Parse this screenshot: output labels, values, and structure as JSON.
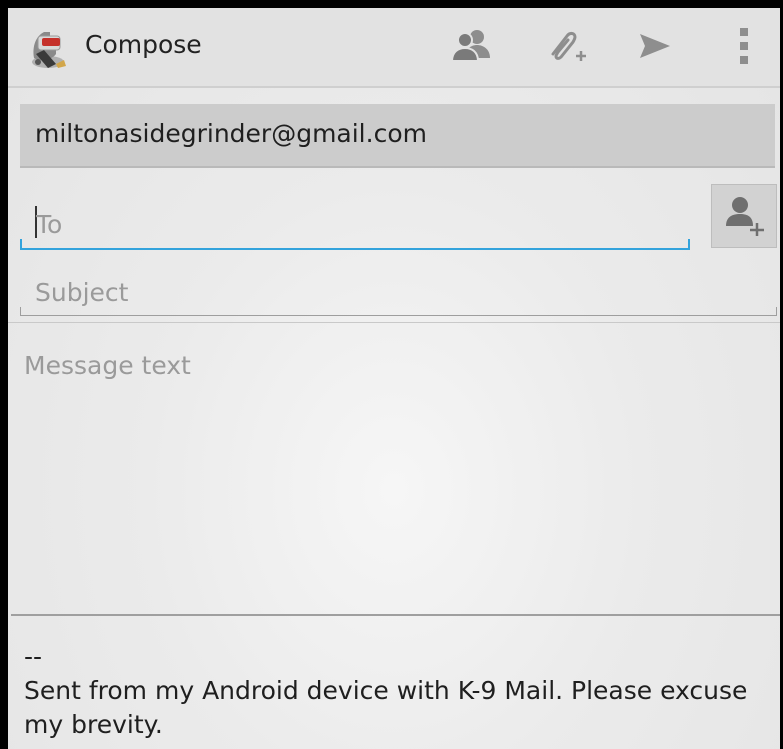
{
  "actionbar": {
    "title": "Compose",
    "icons": {
      "app": "k9-mail-dog-icon",
      "contacts": "contacts-icon",
      "attach": "attach-icon",
      "send": "send-icon",
      "overflow": "overflow-menu-icon"
    }
  },
  "compose": {
    "from_account": "miltonasidegrinder@gmail.com",
    "to": {
      "value": "",
      "placeholder": "To"
    },
    "subject": {
      "value": "",
      "placeholder": "Subject"
    },
    "message": {
      "value": "",
      "placeholder": "Message text"
    },
    "signature_separator": "--",
    "signature_text": "Sent from my Android device with K-9 Mail. Please excuse my brevity."
  },
  "colors": {
    "focus_underline": "#33a3dc",
    "actionbar_bg": "#e2e2e2",
    "from_bg": "#cccccc",
    "placeholder": "#9a9a9a"
  }
}
